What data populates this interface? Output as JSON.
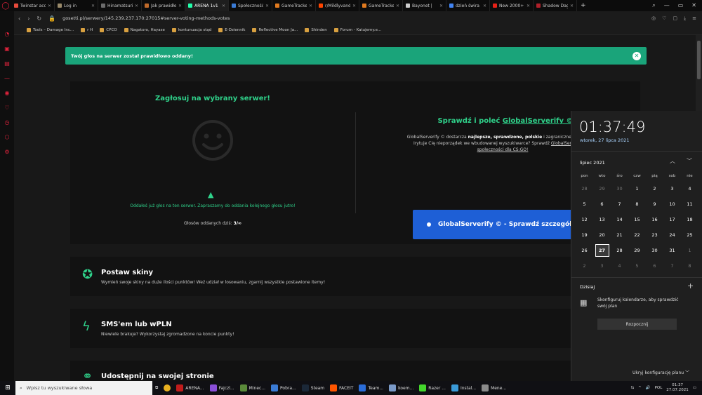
{
  "tabs": [
    {
      "label": "Twinstar acc",
      "color": "#e84b3c"
    },
    {
      "label": "Log in",
      "color": "#9a8a6a"
    },
    {
      "label": "Hinamatsuri",
      "color": "#6b6b6b"
    },
    {
      "label": "Jak prawidło",
      "color": "#c06a2a"
    },
    {
      "label": "ARENA 1v1",
      "color": "#2fa",
      "active": true
    },
    {
      "label": "Społeczność",
      "color": "#3a7bd5"
    },
    {
      "label": "GameTracker",
      "color": "#e07a1f"
    },
    {
      "label": "r/Mildlyvand",
      "color": "#ff4500"
    },
    {
      "label": "GameTracker",
      "color": "#e07a1f"
    },
    {
      "label": "Bayonet |",
      "color": "#ccc"
    },
    {
      "label": "dzień świra c",
      "color": "#4285f4"
    },
    {
      "label": "New 2000+",
      "color": "#e62117"
    },
    {
      "label": "Shadow Dag",
      "color": "#b0202a"
    }
  ],
  "address": {
    "url": "gosetti.pl/serwery/145.239.237.170:27015#server-voting-methods-votes"
  },
  "bookmarks": [
    "Tools – Damage Inc...",
    "r H",
    "CPCO",
    "Nagatoro, Hayase",
    "kontunuacja stąd",
    "E-Dziennik",
    "Reflective Moon Ja...",
    "Shinden",
    "Forum - Katujemy.e..."
  ],
  "alert": {
    "text": "Twój głos na serwer został prawidłowo oddany!",
    "close": "✕"
  },
  "vote": {
    "title": "Zagłosuj na wybrany serwer!",
    "message": "Oddałeś już głos na ten serwer. Zapraszamy do oddania kolejnego głosu jutro!",
    "count_label": "Głosów oddanych dziś:",
    "count_value": "3/∞",
    "right_title_prefix": "Sprawdź i poleć",
    "right_title_link": "GlobalServerify ©",
    "right_desc_1": "GlobalServerify © dostarcza",
    "right_desc_bold": "najlepsze, sprawdzone, polskie",
    "right_desc_2": "i zagraniczne serwery bez",
    "right_desc_3": "Irytuje Cię nieporządek we wbudowanej wyszukiwarce? Sprawdź",
    "right_desc_link": "GlobalServerify © -",
    "right_desc_4": "społeczności dla CS:GO!",
    "button": "GlobalServerify © - Sprawdź szczegóły"
  },
  "cards": [
    {
      "title": "Postaw skiny",
      "desc": "Wymień swoje skiny na duże ilości punktów! Weź udział w losowaniu, zgarnij wszystkie postawione itemy!",
      "icon": "🏅"
    },
    {
      "title": "SMS'em lub wPLN",
      "desc": "Niewiele brakuje? Wykorzystaj zgromadzone na koncie punkty!",
      "icon": "⚡"
    },
    {
      "title": "Udostępnij na swojej stronie",
      "desc": "",
      "icon": "🔗"
    }
  ],
  "taskbar": {
    "search_placeholder": "Wpisz tu wyszukiwane słowa",
    "apps": [
      {
        "label": "ARENA...",
        "color": "#c01c1c"
      },
      {
        "label": "Fajczl...",
        "color": "#8a4fd8"
      },
      {
        "label": "Minec...",
        "color": "#5a8a3a"
      },
      {
        "label": "Pobra...",
        "color": "#3a7bd5"
      },
      {
        "label": "Steam",
        "color": "#1b2838"
      },
      {
        "label": "FACEIT",
        "color": "#ff5500"
      },
      {
        "label": "Team...",
        "color": "#2a6cd8"
      },
      {
        "label": "koem...",
        "color": "#7a9ac8"
      },
      {
        "label": "Razer ...",
        "color": "#44d62c"
      },
      {
        "label": "Instal...",
        "color": "#3a9ad8"
      },
      {
        "label": "Mene...",
        "color": "#8a8a8a"
      }
    ],
    "lang": "POL",
    "time": "01:37",
    "date": "27.07.2021"
  },
  "calendar": {
    "time": "01:37:49",
    "date": "wtorek, 27 lipca 2021",
    "month": "lipiec 2021",
    "weekdays": [
      "pon",
      "wto",
      "śro",
      "czw",
      "pią",
      "sob",
      "nie"
    ],
    "weeks": [
      [
        "28",
        "29",
        "30",
        "1",
        "2",
        "3",
        "4"
      ],
      [
        "5",
        "6",
        "7",
        "8",
        "9",
        "10",
        "11"
      ],
      [
        "12",
        "13",
        "14",
        "15",
        "16",
        "17",
        "18"
      ],
      [
        "19",
        "20",
        "21",
        "22",
        "23",
        "24",
        "25"
      ],
      [
        "26",
        "27",
        "28",
        "29",
        "30",
        "31",
        "1"
      ],
      [
        "2",
        "3",
        "4",
        "5",
        "6",
        "7",
        "8"
      ]
    ],
    "today_label": "Dzisiaj",
    "event_text": "Skonfiguruj kalendarze, aby sprawdzić swój plan",
    "start_button": "Rozpocznij",
    "hide_label": "Ukryj konfigurację planu"
  }
}
